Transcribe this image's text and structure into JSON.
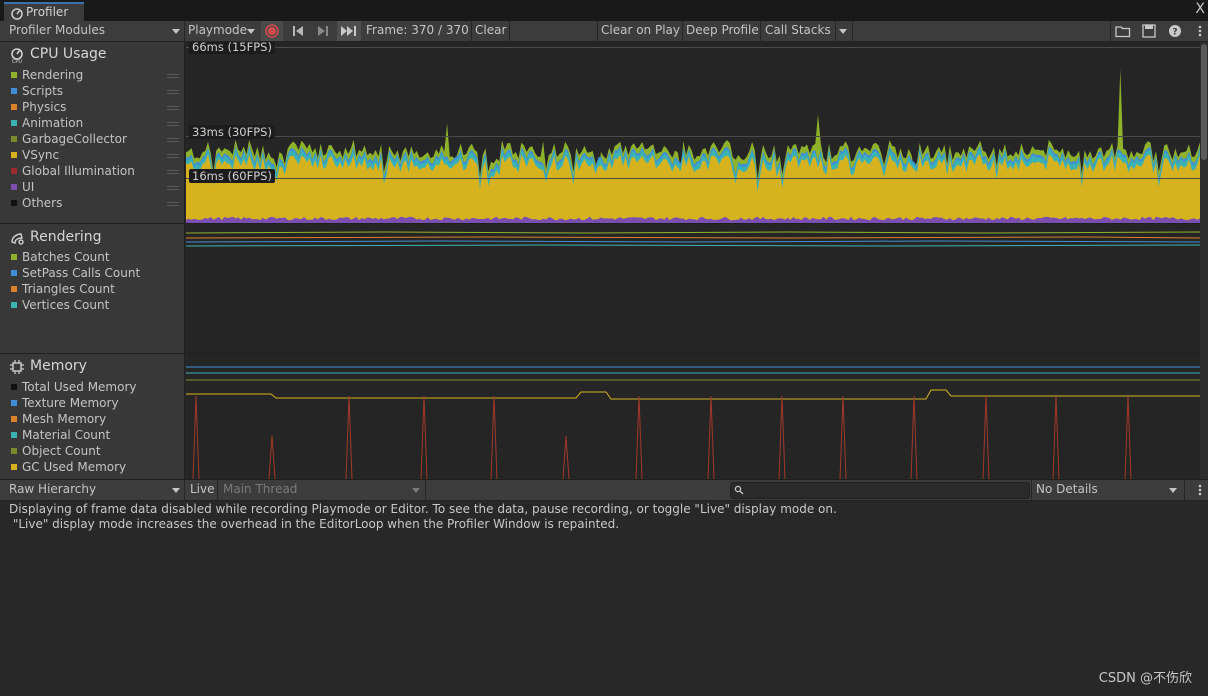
{
  "window": {
    "tab_title": "Profiler",
    "close": "X"
  },
  "toolbar": {
    "modules_dropdown": "Profiler Modules",
    "target_dropdown": "Playmode",
    "frame_label": "Frame: 370 / 370",
    "clear": "Clear",
    "clear_on_play": "Clear on Play",
    "deep_profile": "Deep Profile",
    "call_stacks": "Call Stacks"
  },
  "modules": {
    "cpu": {
      "title": "CPU Usage",
      "fps_labels": [
        "66ms (15FPS)",
        "33ms (30FPS)",
        "16ms (60FPS)"
      ],
      "legend": [
        {
          "name": "Rendering",
          "color": "#8fb22b"
        },
        {
          "name": "Scripts",
          "color": "#3e8fd6"
        },
        {
          "name": "Physics",
          "color": "#d9822b"
        },
        {
          "name": "Animation",
          "color": "#3bb3b3"
        },
        {
          "name": "GarbageCollector",
          "color": "#7a8a2a"
        },
        {
          "name": "VSync",
          "color": "#d6b21f"
        },
        {
          "name": "Global Illumination",
          "color": "#9a2b2b"
        },
        {
          "name": "UI",
          "color": "#7a4fb0"
        },
        {
          "name": "Others",
          "color": "#111111"
        }
      ]
    },
    "rendering": {
      "title": "Rendering",
      "legend": [
        {
          "name": "Batches Count",
          "color": "#8fb22b"
        },
        {
          "name": "SetPass Calls Count",
          "color": "#3e8fd6"
        },
        {
          "name": "Triangles Count",
          "color": "#d9822b"
        },
        {
          "name": "Vertices Count",
          "color": "#3bb3b3"
        }
      ]
    },
    "memory": {
      "title": "Memory",
      "legend": [
        {
          "name": "Total Used Memory",
          "color": "#111111"
        },
        {
          "name": "Texture Memory",
          "color": "#3e8fd6"
        },
        {
          "name": "Mesh Memory",
          "color": "#d9822b"
        },
        {
          "name": "Material Count",
          "color": "#3bb3b3"
        },
        {
          "name": "Object Count",
          "color": "#7a8a2a"
        },
        {
          "name": "GC Used Memory",
          "color": "#d6b21f"
        }
      ]
    }
  },
  "bottom": {
    "view_dropdown": "Raw Hierarchy",
    "live": "Live",
    "thread_dropdown": "Main Thread",
    "details_dropdown": "No Details",
    "message_line1": "Displaying of frame data disabled while recording Playmode or Editor. To see the data, pause recording, or toggle \"Live\" display mode on.",
    "message_line2": " \"Live\" display mode increases the overhead in the EditorLoop when the Profiler Window is repainted."
  },
  "watermark": "CSDN @不伤欣"
}
